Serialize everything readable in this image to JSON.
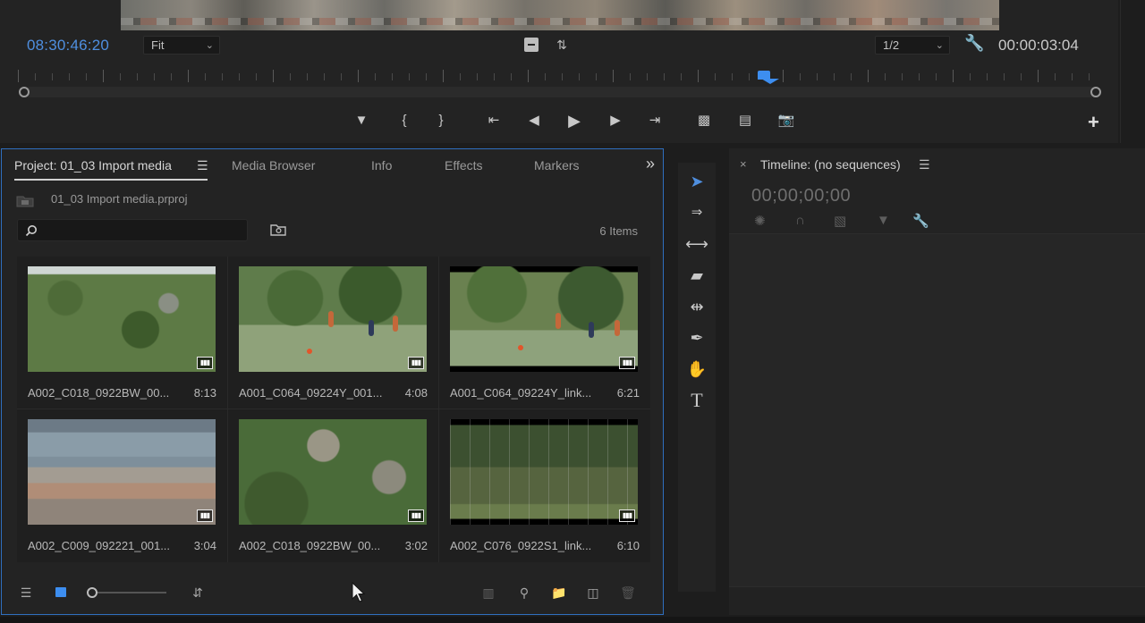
{
  "monitor": {
    "current_timecode": "08:30:46:20",
    "zoom": "Fit",
    "resolution": "1/2",
    "duration_timecode": "00:00:03:04",
    "playhead_position_fraction": 0.69
  },
  "project_panel": {
    "tabs": [
      {
        "label": "Project: 01_03 Import media",
        "active": true
      },
      {
        "label": "Media Browser",
        "active": false
      },
      {
        "label": "Info",
        "active": false
      },
      {
        "label": "Effects",
        "active": false
      },
      {
        "label": "Markers",
        "active": false
      }
    ],
    "menu_glyph": "☰",
    "overflow_glyph": "»",
    "project_file": "01_03 Import media.prproj",
    "search_placeholder": "",
    "item_count": "6 Items",
    "clips": [
      {
        "name": "A002_C018_0922BW_00...",
        "duration": "8:13",
        "thumb": "forest"
      },
      {
        "name": "A001_C064_09224Y_001...",
        "duration": "4:08",
        "thumb": "soccer1"
      },
      {
        "name": "A001_C064_09224Y_link...",
        "duration": "6:21",
        "thumb": "soccer2"
      },
      {
        "name": "A002_C009_092221_001...",
        "duration": "3:04",
        "thumb": "city"
      },
      {
        "name": "A002_C018_0922BW_00...",
        "duration": "3:02",
        "thumb": "ruins"
      },
      {
        "name": "A002_C076_0922S1_link...",
        "duration": "6:10",
        "thumb": "fence"
      }
    ]
  },
  "timeline_panel": {
    "close_glyph": "×",
    "title": "Timeline: (no sequences)",
    "menu_glyph": "☰",
    "timecode": "00;00;00;00"
  },
  "colors": {
    "accent": "#3d8ef0",
    "panel_focus_border": "#2f6fbf",
    "timecode_blue": "#4f8fe0"
  }
}
